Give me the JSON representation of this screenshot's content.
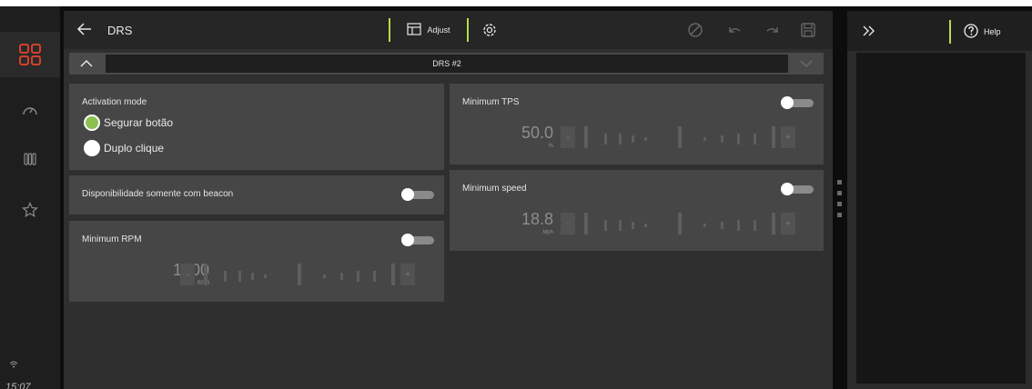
{
  "status": {
    "time": "15:07"
  },
  "header": {
    "title": "DRS",
    "adjust_label": "Adjust"
  },
  "selector": {
    "value": "DRS #2"
  },
  "activation": {
    "label": "Activation mode",
    "options": [
      "Segurar botão",
      "Duplo clique"
    ],
    "selected": "Segurar botão"
  },
  "beacon": {
    "label": "Disponibilidade somente com beacon",
    "enabled": false
  },
  "rpm": {
    "label": "Minimum RPM",
    "value": "1000",
    "unit": "RPM",
    "enabled": false
  },
  "tps": {
    "label": "Minimum TPS",
    "value": "50.0",
    "unit": "%",
    "enabled": false
  },
  "speed": {
    "label": "Minimum speed",
    "value": "18.8",
    "unit": "Mph",
    "enabled": false
  },
  "stepper_labels": {
    "minus": "-",
    "plus": "+"
  },
  "right_panel": {
    "help_label": "Help"
  },
  "colors": {
    "accent": "#b7dc4c",
    "brand": "#e8432d",
    "selected_radio": "#8cc152"
  }
}
